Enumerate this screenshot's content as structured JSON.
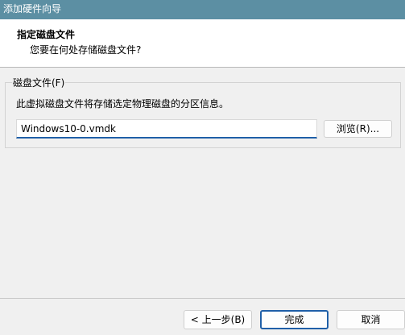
{
  "window": {
    "title": "添加硬件向导"
  },
  "header": {
    "title": "指定磁盘文件",
    "subtitle": "您要在何处存储磁盘文件?"
  },
  "disk_file_group": {
    "legend": "磁盘文件(F)",
    "description": "此虚拟磁盘文件将存储选定物理磁盘的分区信息。",
    "file_value": "Windows10-0.vmdk",
    "browse_label": "浏览(R)..."
  },
  "footer": {
    "back_label": "< 上一步(B)",
    "finish_label": "完成",
    "cancel_label": "取消"
  },
  "colors": {
    "titlebar": "#5c8fa3",
    "accent": "#1f5fa8"
  }
}
